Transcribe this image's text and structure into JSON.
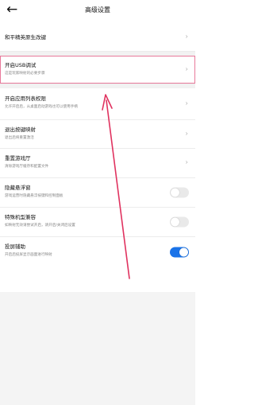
{
  "header": {
    "back_icon": "arrow-left-icon",
    "title": "高级设置"
  },
  "items": [
    {
      "label": "和平精英原生改键",
      "desc": ""
    },
    {
      "label": "开启USB调试",
      "desc": "这是玩家映射的必要步骤"
    },
    {
      "label": "开启应用列表权限",
      "desc": "允许开启后，从桌面启动游戏也可以使用手柄"
    },
    {
      "label": "退出按键映射",
      "desc": "退出后将重置激活"
    },
    {
      "label": "重置游戏厅",
      "desc": "清除游戏厅缓存和配置文件"
    },
    {
      "label": "隐藏悬浮窗",
      "desc": "游戏运营时隐藏悬浮按键和控制面板",
      "toggle": false
    },
    {
      "label": "特殊机型兼容",
      "desc": "如映射无效请尝试开启，请开启/关闭后设置",
      "toggle": false
    },
    {
      "label": "投屏辅助",
      "desc": "开启后投屏显示画面进行映射",
      "toggle": true
    }
  ],
  "colors": {
    "highlight_border": "#e8799a",
    "annotation_arrow": "#e0325f",
    "toggle_on": "#1a73e8",
    "toggle_off": "#e9e9e9"
  }
}
